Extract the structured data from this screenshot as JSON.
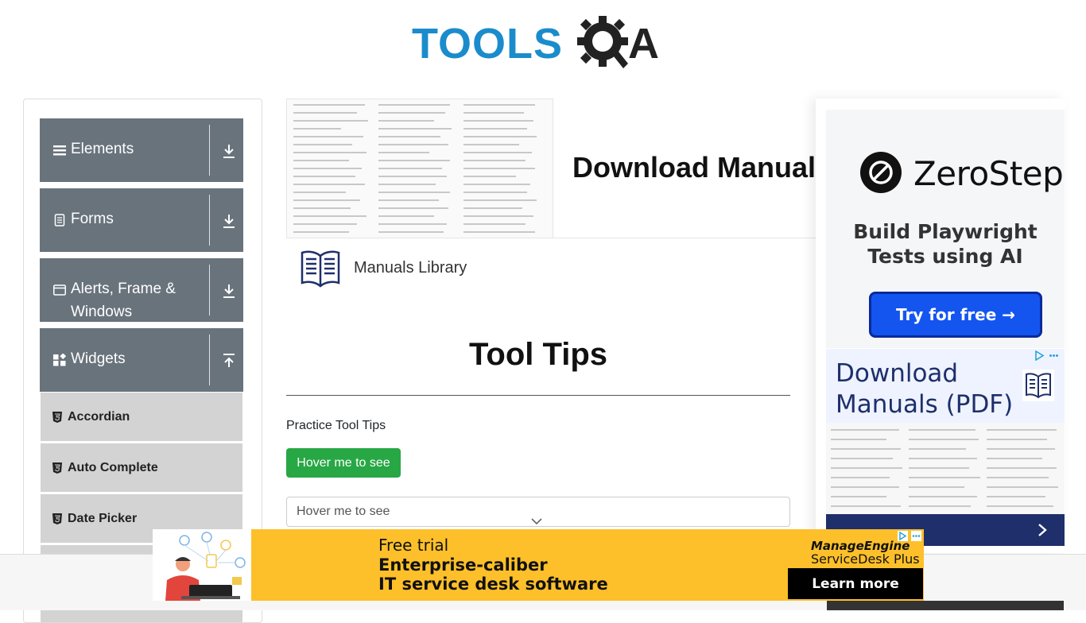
{
  "logo": {
    "text": "TOOLS",
    "suffix": "A"
  },
  "sidebar": {
    "groups": [
      {
        "label": "Elements",
        "icon": "hamburger-icon",
        "arrow": "download-arrow-icon"
      },
      {
        "label": "Forms",
        "icon": "document-icon",
        "arrow": "download-arrow-icon"
      },
      {
        "label_line1": "Alerts, Frame &",
        "label_line2": "Windows",
        "icon": "window-icon",
        "arrow": "download-arrow-icon"
      },
      {
        "label": "Widgets",
        "icon": "widgets-icon",
        "arrow": "upload-arrow-icon"
      }
    ],
    "items": [
      {
        "label": "Accordian",
        "icon": "html5-icon"
      },
      {
        "label": "Auto Complete",
        "icon": "html5-icon"
      },
      {
        "label": "Date Picker",
        "icon": "html5-icon"
      }
    ]
  },
  "ad_top": {
    "title": "Download Manuals",
    "library_label": "Manuals Library"
  },
  "main": {
    "page_title": "Tool Tips",
    "practice_label": "Practice Tool Tips",
    "hover_button": "Hover me to see",
    "hover_input_placeholder": "Hover me to see"
  },
  "right_ad": {
    "brand": "ZeroStep",
    "tagline_line1": "Build Playwright",
    "tagline_line2": "Tests using AI",
    "cta": "Try for free →",
    "manuals_title_line1": "Download",
    "manuals_title_line2": "Manuals (PDF)"
  },
  "banner": {
    "trial": "Free trial",
    "line1": "Enterprise-caliber",
    "line2": "IT service desk software",
    "brand_line1": "ManageEngine",
    "brand_line2": "ServiceDesk Plus",
    "cta": "Learn more"
  },
  "colors": {
    "sidebar_header": "#69737c",
    "sidebar_item": "#d3d3d3",
    "button_green": "#28a745",
    "logo_blue": "#1a8ccc",
    "zerostep_blue": "#1455f0",
    "banner_yellow": "#fdc02a",
    "manuals_navy": "#1e2f6b"
  }
}
